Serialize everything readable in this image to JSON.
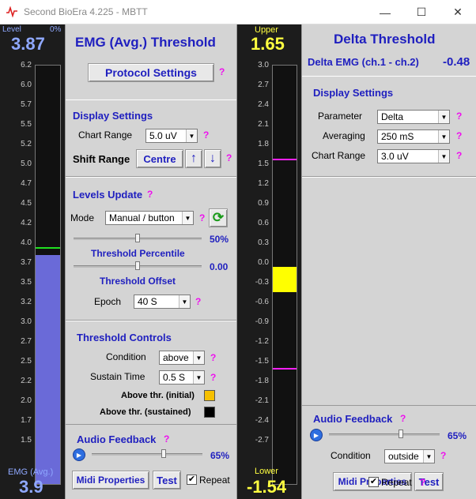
{
  "window": {
    "title": "Second BioEra 4.225 - MBTT",
    "minimize": "—",
    "maximize": "☐",
    "close": "✕"
  },
  "left_meter": {
    "label": "Level",
    "pct": "0%",
    "value": "3.87",
    "bottom_label": "EMG (Avg.)",
    "bottom_value": "3.9",
    "ticks": [
      "6.2",
      "6.0",
      "5.7",
      "5.5",
      "5.2",
      "5.0",
      "4.7",
      "4.5",
      "4.2",
      "4.0",
      "3.7",
      "3.5",
      "3.2",
      "3.0",
      "2.7",
      "2.5",
      "2.2",
      "2.0",
      "1.7",
      "1.5"
    ],
    "fill_level": 3.87,
    "threshold": 3.95,
    "axis_max": 6.2,
    "axis_min": 1.2
  },
  "emg": {
    "title": "EMG (Avg.) Threshold",
    "protocol_btn": "Protocol Settings",
    "q": "?",
    "display": {
      "title": "Display Settings",
      "chart_range_label": "Chart Range",
      "chart_range_value": "5.0 uV",
      "shift_label": "Shift Range",
      "centre_btn": "Centre",
      "up_icon": "↑",
      "down_icon": "↓"
    },
    "levels": {
      "title": "Levels Update",
      "mode_label": "Mode",
      "mode_value": "Manual / button",
      "refresh_icon": "⟳",
      "percentile_value": "50%",
      "percentile_label": "Threshold Percentile",
      "percentile_level": 0.5,
      "offset_value": "0.00",
      "offset_label": "Threshold Offset",
      "offset_level": 0.5,
      "epoch_label": "Epoch",
      "epoch_value": "40 S"
    },
    "controls": {
      "title": "Threshold Controls",
      "condition_label": "Condition",
      "condition_value": "above",
      "sustain_label": "Sustain Time",
      "sustain_value": "0.5 S",
      "initial_label": "Above thr. (initial)",
      "sustained_label": "Above thr. (sustained)",
      "initial_color": "#f6c000",
      "sustained_color": "#000000"
    },
    "audio": {
      "title": "Audio Feedback",
      "volume": "65%",
      "volume_level": 0.65,
      "midi_btn": "Midi Properties",
      "test_btn": "Test",
      "repeat_label": "Repeat",
      "repeat_checked": "✔"
    }
  },
  "mid_meter": {
    "upper_label": "Upper",
    "upper_value": "1.65",
    "lower_label": "Lower",
    "lower_value": "-1.54",
    "ticks": [
      "3.0",
      "2.7",
      "2.4",
      "2.1",
      "1.8",
      "1.5",
      "1.2",
      "0.9",
      "0.6",
      "0.3",
      "0.0",
      "-0.3",
      "-0.6",
      "-0.9",
      "-1.2",
      "-1.5",
      "-1.8",
      "-2.1",
      "-2.4",
      "-2.7"
    ],
    "axis_max": 3.0,
    "axis_min": -3.0,
    "bar_top": 0.0,
    "bar_bottom": -0.38
  },
  "delta": {
    "title": "Delta Threshold",
    "subtitle": "Delta EMG (ch.1 - ch.2)",
    "value": "-0.48",
    "q": "?",
    "display": {
      "title": "Display Settings",
      "param_label": "Parameter",
      "param_value": "Delta",
      "avg_label": "Averaging",
      "avg_value": "250 mS",
      "range_label": "Chart Range",
      "range_value": "3.0 uV"
    },
    "audio": {
      "title": "Audio Feedback",
      "volume": "65%",
      "volume_level": 0.65,
      "condition_label": "Condition",
      "condition_value": "outside",
      "midi_btn": "Midi Properties",
      "test_btn": "Test",
      "repeat_label": "Repeat",
      "repeat_checked": "✔"
    }
  },
  "colors": {
    "accent": "#1f1fbf",
    "help": "#ee10ee",
    "meter_fill": "#6a6ad8",
    "value_yellow": "#ffff40",
    "threshold_magenta": "#ff20ff"
  }
}
